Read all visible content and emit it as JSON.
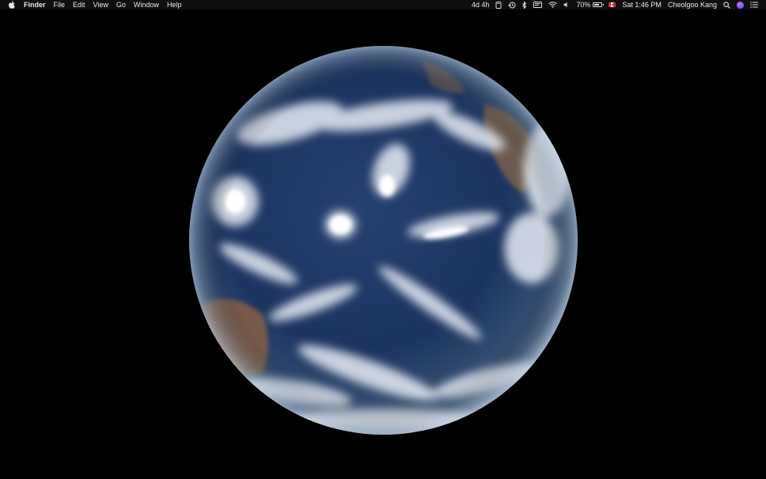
{
  "menubar": {
    "app_name": "Finder",
    "menus": [
      "File",
      "Edit",
      "View",
      "Go",
      "Window",
      "Help"
    ],
    "status": {
      "time_remaining": "4d 4h",
      "battery_percent": "70%",
      "battery_level": 0.7,
      "clock": "Sat 1:46 PM",
      "user": "Cheolgoo Kang",
      "input_source": "canada-flag-icon"
    },
    "icons": [
      "apple-icon",
      "document-icon",
      "time-machine-icon",
      "bluetooth-icon",
      "flag-icon",
      "wifi-icon",
      "volume-icon",
      "battery-icon",
      "search-icon",
      "siri-icon",
      "notification-center-icon"
    ]
  },
  "desktop": {
    "wallpaper": "earth-from-space",
    "colors": {
      "background": "#000000",
      "ocean": "#1e3560",
      "cloud": "#e8edf4",
      "land": "#7a6148"
    }
  }
}
